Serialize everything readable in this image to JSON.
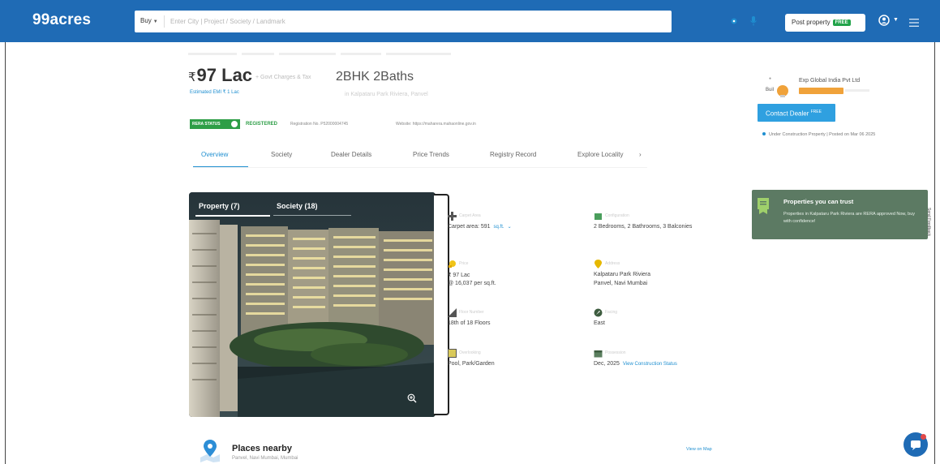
{
  "header": {
    "logo": "99acres",
    "search": {
      "type_label": "Buy",
      "placeholder": "Enter City | Project / Society / Landmark"
    },
    "post_property_label": "Post property",
    "free_badge": "FREE"
  },
  "property": {
    "price_symbol": "₹",
    "price": "97 Lac",
    "price_note": "+ Govt Charges & Tax",
    "title": "2BHK 2Baths",
    "emi_link": "Estimated EMI ₹ 1 Lac",
    "subtitle": "in Kalpataru Park Riviera, Panvel",
    "rera_badge": "RERA STATUS",
    "registered": "REGISTERED",
    "registration_no": "Registration No. P52000004745",
    "website": "Website: https://maharera.mahaonline.gov.in"
  },
  "tabs": [
    "Overview",
    "Society",
    "Dealer Details",
    "Price Trends",
    "Registry Record",
    "Explore Locality"
  ],
  "tabs_more": "›",
  "dealer": {
    "name": "Exp Global India Pvt Ltd",
    "contact_label": "Contact Dealer",
    "contact_sup": "FREE",
    "meta": "Under Construction Property  |  Posted on Mar 06 2025"
  },
  "gallery": {
    "tab_property": "Property (7)",
    "tab_society": "Society (18)"
  },
  "features": [
    {
      "label": "Carpet Area",
      "value": "Carpet area: 591",
      "unit_link": "sq.ft.",
      "value2": ""
    },
    {
      "label": "Configuration",
      "value": "2 Bedrooms, 2 Bathrooms, 3 Balconies",
      "value2": ""
    },
    {
      "label": "Price",
      "value": "₹ 97 Lac",
      "value2": "@ 16,037 per sq.ft."
    },
    {
      "label": "Address",
      "value": "Kalpataru Park Riviera",
      "value2": "Panvel, Navi Mumbai"
    },
    {
      "label": "Floor Number",
      "value": "18th of 18 Floors",
      "value2": ""
    },
    {
      "label": "Facing",
      "value": "East",
      "value2": ""
    },
    {
      "label": "Overlooking",
      "value": "Pool, Park/Garden",
      "value2": ""
    },
    {
      "label": "Possession",
      "value": "Dec, 2025",
      "link": "View Construction Status",
      "value2": ""
    }
  ],
  "trust": {
    "title": "Properties you can trust",
    "body": "Properties in Kalpataru Park Riviera are RERA approved Now, buy with confidence!"
  },
  "feedback": "Send Feedback",
  "places": {
    "title": "Places nearby",
    "subtitle": "Panvel, Navi Mumbai, Mumbai",
    "link": "View on Map"
  }
}
